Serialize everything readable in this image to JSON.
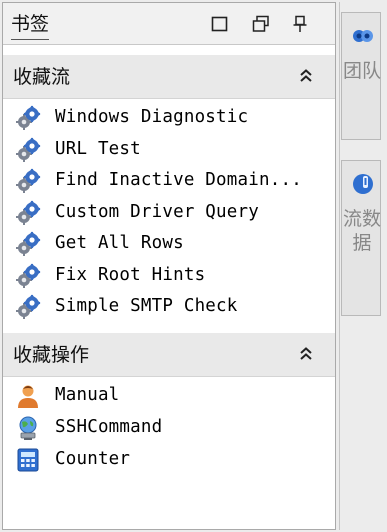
{
  "bookmarks_panel": {
    "title": "书签",
    "controls": {
      "window_icon": "window-icon",
      "restore_icon": "restore-icon",
      "pin_icon": "pin-icon"
    }
  },
  "favorite_flows": {
    "header": "收藏流",
    "collapse_icon": "double-chevron-up-icon",
    "items": [
      {
        "label": "Windows Diagnostic",
        "icon": "gear-flow-icon"
      },
      {
        "label": "URL Test",
        "icon": "gear-flow-icon"
      },
      {
        "label": "Find Inactive Domain...",
        "icon": "gear-flow-icon"
      },
      {
        "label": "Custom Driver Query",
        "icon": "gear-flow-icon"
      },
      {
        "label": "Get All Rows",
        "icon": "gear-flow-icon"
      },
      {
        "label": "Fix Root Hints",
        "icon": "gear-flow-icon"
      },
      {
        "label": "Simple SMTP Check",
        "icon": "gear-flow-icon"
      }
    ]
  },
  "favorite_actions": {
    "header": "收藏操作",
    "collapse_icon": "double-chevron-up-icon",
    "items": [
      {
        "label": "Manual",
        "icon": "person-icon"
      },
      {
        "label": "SSHCommand",
        "icon": "globe-computer-icon"
      },
      {
        "label": "Counter",
        "icon": "calculator-icon"
      }
    ]
  },
  "side_tabs": [
    {
      "label": "团队",
      "icon": "team-icon"
    },
    {
      "label": "流数据",
      "icon": "flow-data-icon"
    }
  ],
  "colors": {
    "accent_blue": "#2f6fd0",
    "gear_blue": "#3a6fc4",
    "person_orange": "#e07a2e"
  }
}
